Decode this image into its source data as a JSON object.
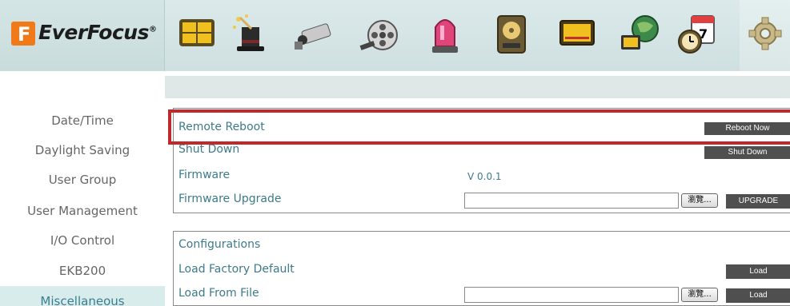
{
  "logo": {
    "mark": "F",
    "name": "EverFocus",
    "reg": "®"
  },
  "toolbar_icons": [
    "layout-grid-icon",
    "magic-wand-icon",
    "camera-icon",
    "film-reel-icon",
    "alarm-light-icon",
    "hard-drive-icon",
    "monitor-icon",
    "network-globe-icon",
    "schedule-clock-icon",
    "gear-icon"
  ],
  "sidebar": {
    "items": [
      {
        "label": "Date/Time"
      },
      {
        "label": "Daylight Saving"
      },
      {
        "label": "User Group"
      },
      {
        "label": "User Management"
      },
      {
        "label": "I/O Control"
      },
      {
        "label": "EKB200"
      },
      {
        "label": "Miscellaneous"
      }
    ]
  },
  "system": {
    "remote_reboot_label": "Remote Reboot",
    "reboot_button": "Reboot Now",
    "shutdown_label": "Shut Down",
    "shutdown_button": "Shut Down",
    "firmware_label": "Firmware",
    "firmware_value": "V  0.0.1",
    "firmware_upgrade_label": "Firmware Upgrade",
    "browse_button": "瀏覽...",
    "upgrade_button": "UPGRADE"
  },
  "config": {
    "title": "Configurations",
    "factory_label": "Load Factory Default",
    "factory_button": "Load",
    "from_file_label": "Load From File",
    "browse_button": "瀏覽...",
    "from_file_button": "Load"
  },
  "colors": {
    "accent": "#3c7b8a",
    "highlight": "#c0282c",
    "button": "#4f4f4f"
  }
}
